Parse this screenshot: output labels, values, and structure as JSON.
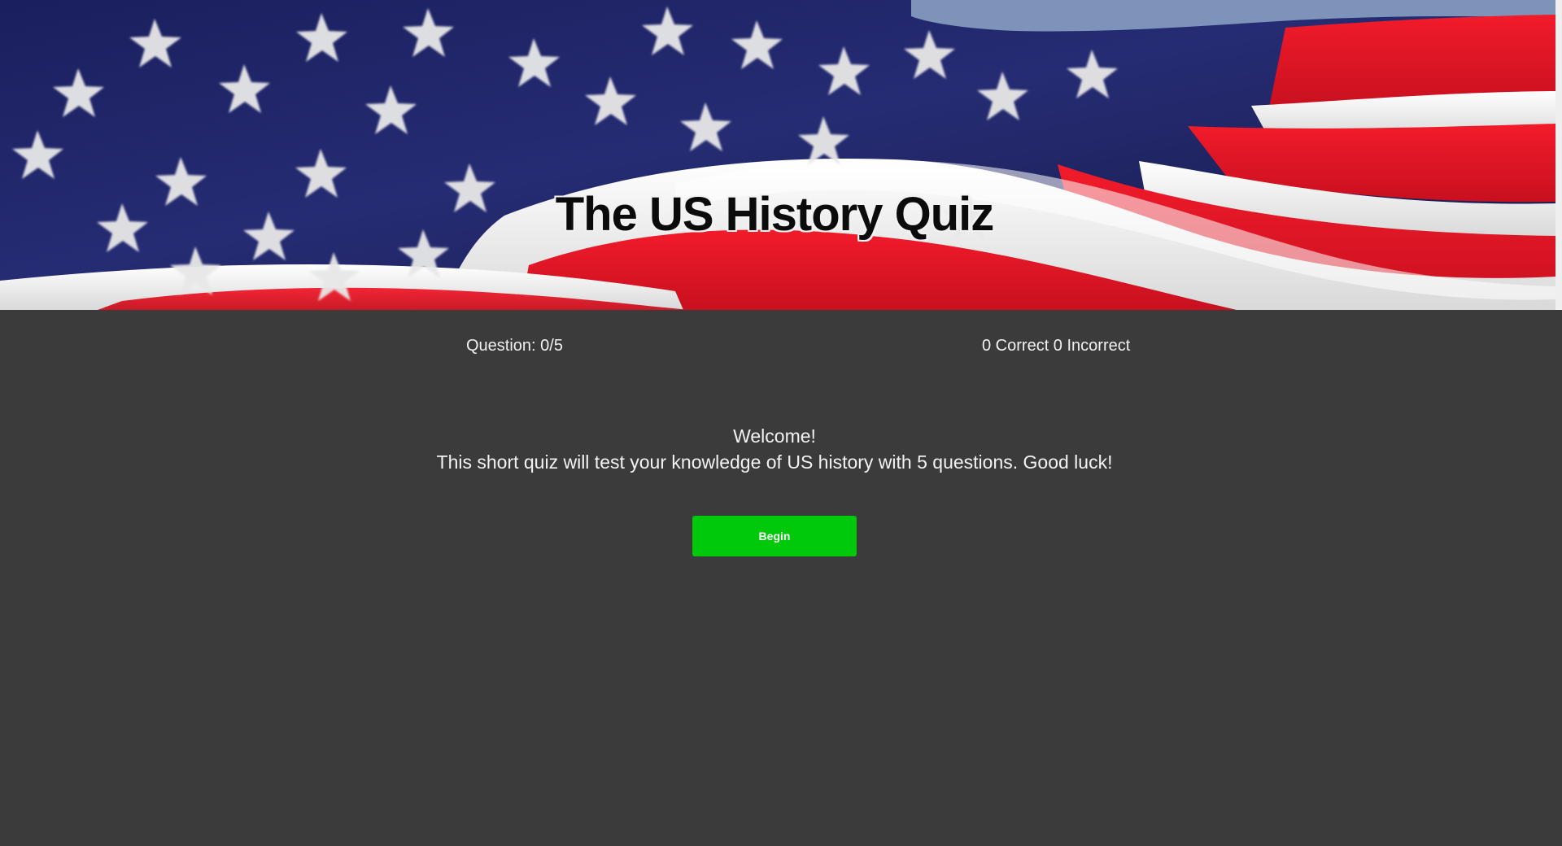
{
  "header": {
    "title": "The US History Quiz"
  },
  "stats": {
    "question": "Question: 0/5",
    "score": "0 Correct 0 Incorrect"
  },
  "welcome": {
    "heading": "Welcome!",
    "description": "This short quiz will test your knowledge of US history with 5 questions. Good luck!"
  },
  "actions": {
    "begin_label": "Begin"
  },
  "colors": {
    "background": "#3b3b3b",
    "button": "#00c80a",
    "text": "#f2f2f2",
    "flag_blue": "#1f2766",
    "flag_red": "#ee1c2e",
    "flag_white": "#f6f6f6"
  }
}
